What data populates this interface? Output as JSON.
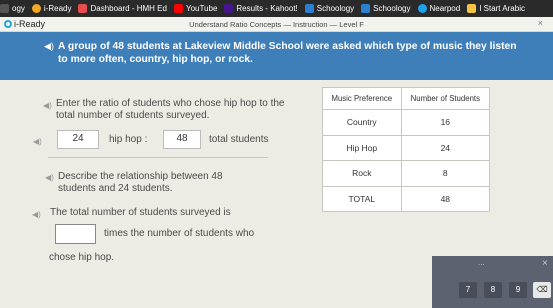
{
  "bookmarks": [
    {
      "label": "ogy",
      "color": "#555555"
    },
    {
      "label": "i-Ready",
      "color": "#f5a623"
    },
    {
      "label": "Dashboard - HMH Ed",
      "color": "#e84c4c"
    },
    {
      "label": "YouTube",
      "color": "#ff0000"
    },
    {
      "label": "Results - Kahoot!",
      "color": "#46178f"
    },
    {
      "label": "Schoology",
      "color": "#2d7fd1"
    },
    {
      "label": "Schoology",
      "color": "#2d7fd1"
    },
    {
      "label": "Nearpod",
      "color": "#1aa3e8"
    },
    {
      "label": "I Start Arabic",
      "color": "#f4c542"
    }
  ],
  "app": {
    "logo_text": "i-Ready",
    "lesson_title": "Understand Ratio Concepts — Instruction — Level F",
    "close": "×"
  },
  "banner": {
    "speaker": "◀)",
    "text": "A group of 48 students at Lakeview Middle School were asked which type of music they listen to more often, country, hip hop, or rock."
  },
  "q1": {
    "text": "Enter the ratio of students who chose hip hop to the total number of students surveyed.",
    "value1": "24",
    "sep": "hip hop :",
    "value2": "48",
    "suffix": "total students"
  },
  "q2": {
    "text": "Describe the relationship between 48 students and 24 students."
  },
  "q3": {
    "line1": "The total number of students surveyed is",
    "answer": "",
    "line2": "times the number of students who",
    "line3": "chose hip hop."
  },
  "table": {
    "headers": [
      "Music Preference",
      "Number of Students"
    ],
    "rows": [
      {
        "music": "Country",
        "count": "16"
      },
      {
        "music": "Hip Hop",
        "count": "24"
      },
      {
        "music": "Rock",
        "count": "8"
      },
      {
        "music": "TOTAL",
        "count": "48"
      }
    ]
  },
  "keypad": {
    "dots": "...",
    "close": "×",
    "keys": [
      "7",
      "8",
      "9",
      "⌫"
    ]
  }
}
